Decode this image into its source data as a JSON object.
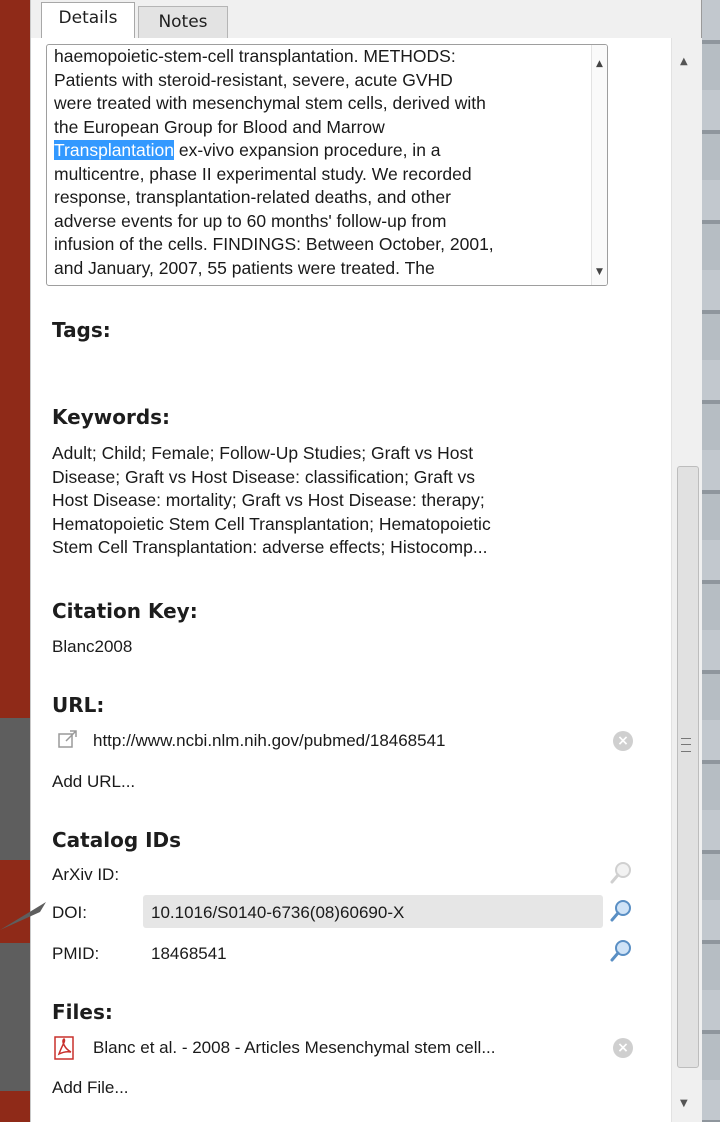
{
  "tabs": [
    {
      "label": "Details"
    },
    {
      "label": "Notes"
    }
  ],
  "abstract": {
    "lines": [
      "haemopoietic-stem-cell transplantation. METHODS:",
      "Patients with steroid-resistant, severe, acute GVHD",
      "were treated with mesenchymal stem cells, derived with",
      "the European Group for Blood and Marrow",
      " ex-vivo expansion procedure, in a",
      "multicentre, phase II experimental study. We recorded",
      "response, transplantation-related deaths, and other",
      "adverse events for up to 60 months' follow-up from",
      "infusion of the cells. FINDINGS: Between October, 2001,",
      "and January, 2007, 55 patients were treated. The"
    ],
    "highlighted_word": "Transplantation"
  },
  "tags": {
    "label": "Tags:"
  },
  "keywords": {
    "label": "Keywords:",
    "lines": [
      "Adult; Child; Female; Follow-Up Studies; Graft vs Host",
      "Disease; Graft vs Host Disease: classification; Graft vs",
      "Host Disease: mortality; Graft vs Host Disease: therapy;",
      "Hematopoietic Stem Cell Transplantation; Hematopoietic",
      "Stem Cell Transplantation: adverse effects; Histocomp..."
    ]
  },
  "citation_key": {
    "label": "Citation Key:",
    "value": "Blanc2008"
  },
  "url": {
    "label": "URL:",
    "value": "http://www.ncbi.nlm.nih.gov/pubmed/18468541",
    "add_label": "Add URL..."
  },
  "catalog": {
    "label": "Catalog IDs",
    "arxiv_label": "ArXiv ID:",
    "doi_label": "DOI:",
    "doi_value": "10.1016/S0140-6736(08)60690-X",
    "pmid_label": "PMID:",
    "pmid_value": "18468541"
  },
  "files": {
    "label": "Files:",
    "file_name": "Blanc et al. - 2008 - Articles Mesenchymal stem cell...",
    "add_label": "Add File..."
  },
  "icons": {
    "external_link": "external-link-icon",
    "clear": "clear-icon",
    "search": "search-icon",
    "pdf": "pdf-icon"
  },
  "colors": {
    "background": "#8f2a18",
    "highlight": "#3399ff",
    "muted_text": "#a7a7a7"
  }
}
